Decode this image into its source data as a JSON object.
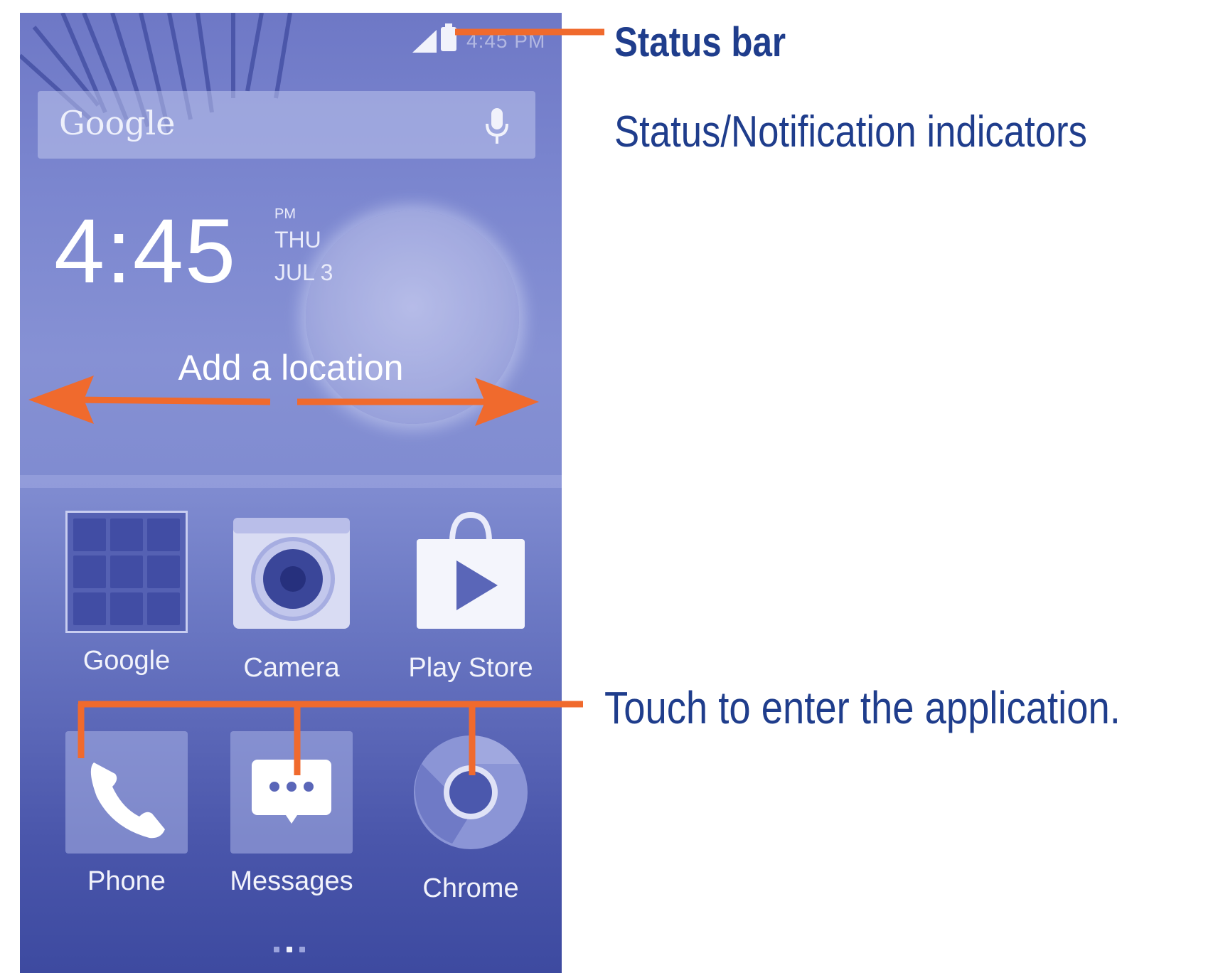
{
  "phone": {
    "status_bar": {
      "time": "4:45 PM"
    },
    "search": {
      "logo_text": "Google",
      "mic_icon": "mic-icon"
    },
    "clock": {
      "time": "4:45",
      "ampm": "PM",
      "day": "THU",
      "date": "JUL 3"
    },
    "weather": {
      "location_prompt": "Add a location"
    },
    "apps": [
      {
        "label": "Google",
        "icon": "google-folder-icon"
      },
      {
        "label": "Camera",
        "icon": "camera-icon"
      },
      {
        "label": "Play Store",
        "icon": "play-store-icon"
      }
    ],
    "dock": [
      {
        "label": "Phone",
        "icon": "phone-icon"
      },
      {
        "label": "Messages",
        "icon": "messages-icon"
      },
      {
        "label": "Chrome",
        "icon": "chrome-icon"
      }
    ],
    "page_indicator": {
      "pages": 3,
      "current": 2
    }
  },
  "annotations": {
    "status_bar": "Status bar",
    "indicators": "Status/Notification indicators",
    "touch": "Touch to enter the application."
  },
  "colors": {
    "annotation_text": "#1f3d8c",
    "annotation_line": "#f06a2d",
    "screen_tint": "#6e78c6"
  }
}
